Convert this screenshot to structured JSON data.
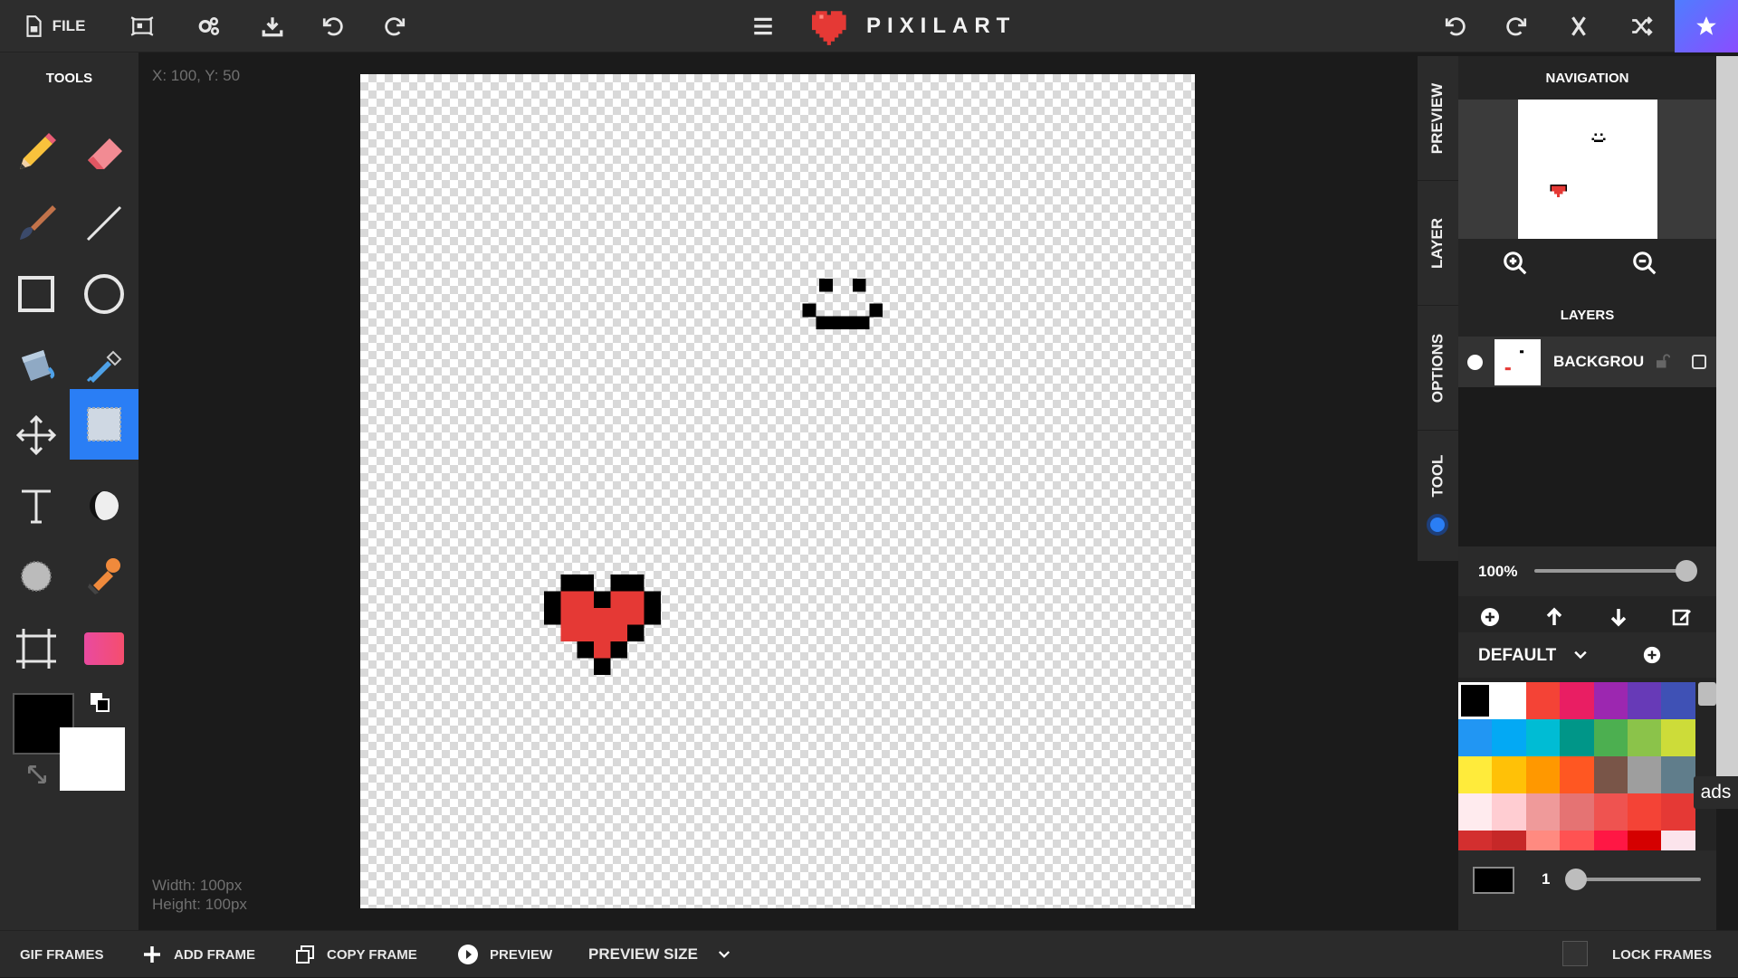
{
  "app": {
    "title": "PIXILART",
    "file_label": "FILE",
    "brand_color": "#e53935"
  },
  "toolbar": {
    "left_icons": [
      "file-icon",
      "resize-icon",
      "settings-icon",
      "download-icon",
      "undo-icon",
      "redo-icon"
    ],
    "center_icon": "menu-icon",
    "right_icons": [
      "undo-icon",
      "redo-icon",
      "arrows-icon",
      "shuffle-icon",
      "star-icon"
    ]
  },
  "tools": {
    "title": "TOOLS",
    "items": [
      "pencil",
      "eraser",
      "brush",
      "line",
      "rectangle",
      "circle",
      "paint-bucket",
      "eyedropper",
      "move",
      "select",
      "text",
      "shade",
      "dither",
      "stamp",
      "crop",
      "gradient"
    ],
    "active": "select",
    "primary_color": "#000000",
    "secondary_color": "#ffffff"
  },
  "workspace": {
    "coords": "X: 100, Y: 50",
    "width_label": "Width: 100px",
    "height_label": "Height: 100px"
  },
  "side_tabs": [
    "PREVIEW",
    "LAYER",
    "OPTIONS",
    "TOOL"
  ],
  "navigation": {
    "title": "NAVIGATION"
  },
  "layers": {
    "title": "LAYERS",
    "items": [
      {
        "name": "BACKGROUND",
        "visible": true
      }
    ],
    "opacity": "100%",
    "opacity_value": 1.0
  },
  "palette": {
    "name": "DEFAULT",
    "colors": [
      "#000000",
      "#ffffff",
      "#f44336",
      "#e91e63",
      "#9c27b0",
      "#673ab7",
      "#3f51b5",
      "#2196f3",
      "#03a9f4",
      "#00bcd4",
      "#009688",
      "#4caf50",
      "#8bc34a",
      "#cddc39",
      "#ffeb3b",
      "#ffc107",
      "#ff9800",
      "#ff5722",
      "#795548",
      "#9e9e9e",
      "#607d8b",
      "#ffebee",
      "#ffcdd2",
      "#ef9a9a",
      "#e57373",
      "#ef5350",
      "#f44336",
      "#e53935",
      "#d32f2f",
      "#c62828",
      "#ff8a80",
      "#ff5252",
      "#ff1744",
      "#d50000",
      "#fce4ec"
    ],
    "selected_index": 0
  },
  "brush": {
    "color": "#000000",
    "size": "1"
  },
  "ads_label": "ads",
  "bottom": {
    "gif_frames": "GIF FRAMES",
    "add_frame": "ADD FRAME",
    "copy_frame": "COPY FRAME",
    "preview": "PREVIEW",
    "preview_size": "PREVIEW SIZE",
    "lock_frames": "LOCK FRAMES"
  }
}
